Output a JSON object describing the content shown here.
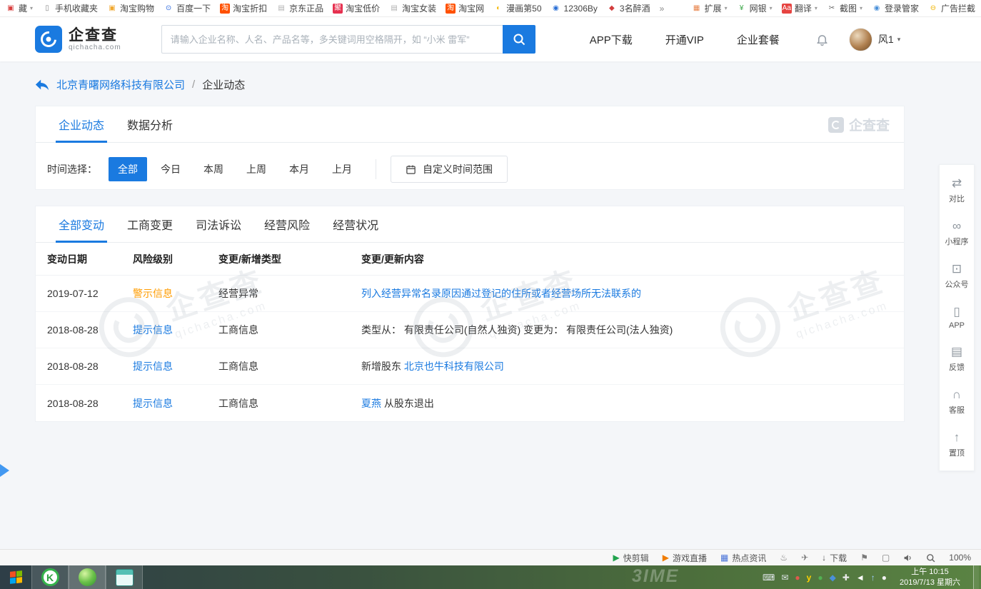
{
  "colors": {
    "brand": "#1a7ae0",
    "warning": "#ff9c00",
    "text": "#333333"
  },
  "bookmarks_bar": {
    "fold": {
      "glyph": "▣",
      "label": "藏",
      "icon_style": "color:#d94040"
    },
    "caret": "▾",
    "items": [
      {
        "label": "手机收藏夹",
        "glyph": "▯",
        "icon_style": "color:#8a8a8a"
      },
      {
        "label": "淘宝购物",
        "glyph": "▣",
        "icon_style": "color:#f0a830"
      },
      {
        "label": "百度一下",
        "glyph": "⊙",
        "icon_style": "color:#2d6adf"
      },
      {
        "label": "淘宝折扣",
        "glyph": "淘",
        "icon_style": "background:#ff5000;color:#fff"
      },
      {
        "label": "京东正品",
        "glyph": "▤",
        "icon_style": "color:#b0b0b0"
      },
      {
        "label": "淘宝低价",
        "glyph": "聚",
        "icon_style": "background:#e6304f;color:#fff"
      },
      {
        "label": "淘宝女装",
        "glyph": "▤",
        "icon_style": "color:#b0b0b0"
      },
      {
        "label": "淘宝网",
        "glyph": "淘",
        "icon_style": "background:#ff5000;color:#fff"
      },
      {
        "label": "漫画第50",
        "glyph": "◐",
        "icon_style": "color:#f5b800"
      },
      {
        "label": "12306By",
        "glyph": "◉",
        "icon_style": "color:#2a6fd6"
      },
      {
        "label": "3名醉酒",
        "glyph": "◆",
        "icon_style": "color:#d23c3c"
      }
    ],
    "overflow": "»",
    "right_items": [
      {
        "label": "扩展",
        "glyph": "▦",
        "icon_style": "color:#e8834a"
      },
      {
        "label": "网银",
        "glyph": "¥",
        "icon_style": "color:#3aa546"
      },
      {
        "label": "翻译",
        "glyph": "Aa",
        "icon_style": "background:#e64340;color:#fff"
      },
      {
        "label": "截图",
        "glyph": "✂",
        "icon_style": "color:#666"
      },
      {
        "label": "登录管家",
        "glyph": "◉",
        "icon_style": "color:#4a90d9"
      },
      {
        "label": "广告拦截",
        "glyph": "⊖",
        "icon_style": "color:#f0b400"
      }
    ]
  },
  "header": {
    "logo": {
      "name": "企查查",
      "domain": "qichacha.com"
    },
    "search": {
      "placeholder": "请输入企业名称、人名、产品名等，多关键词用空格隔开，如 “小米 雷军”"
    },
    "nav": [
      {
        "label": "APP下载"
      },
      {
        "label": "开通VIP"
      },
      {
        "label": "企业套餐"
      }
    ],
    "user": {
      "name": "风1",
      "caret": "▾"
    }
  },
  "breadcrumb": {
    "company": "北京青曙网络科技有限公司",
    "separator": "/",
    "current": "企业动态"
  },
  "dynamics": {
    "tabs": [
      {
        "label": "企业动态"
      },
      {
        "label": "数据分析"
      }
    ],
    "watermark_label": "企查查",
    "time_filter": {
      "label": "时间选择：",
      "options": [
        "全部",
        "今日",
        "本周",
        "上周",
        "本月",
        "上月"
      ],
      "active": "全部",
      "custom_label": "自定义时间范围"
    },
    "change_tabs": [
      "全部变动",
      "工商变更",
      "司法诉讼",
      "经营风险",
      "经营状况"
    ],
    "active_change_tab": "全部变动",
    "table": {
      "headers": [
        "变动日期",
        "风险级别",
        "变更/新增类型",
        "变更/更新内容"
      ],
      "rows": [
        {
          "date": "2019-07-12",
          "risk": "警示信息",
          "type": "经营异常",
          "text_before": "",
          "link_text": "列入经营异常名录原因通过登记的住所或者经营场所无法联系的",
          "text_after": ""
        },
        {
          "date": "2018-08-28",
          "risk": "提示信息",
          "type": "工商信息",
          "text_before": "类型从： 有限责任公司(自然人独资) 变更为： 有限责任公司(法人独资)",
          "link_text": "",
          "text_after": ""
        },
        {
          "date": "2018-08-28",
          "risk": "提示信息",
          "type": "工商信息",
          "text_before": "新增股东 ",
          "link_text": "北京也牛科技有限公司",
          "text_after": ""
        },
        {
          "date": "2018-08-28",
          "risk": "提示信息",
          "type": "工商信息",
          "text_before": "",
          "link_text": "夏燕",
          "text_after": " 从股东退出"
        }
      ]
    }
  },
  "right_toolbar": {
    "items": [
      {
        "label": "对比",
        "glyph": "⇄"
      },
      {
        "label": "小程序",
        "glyph": "∞"
      },
      {
        "label": "公众号",
        "glyph": "⊡"
      },
      {
        "label": "APP",
        "glyph": "▯"
      },
      {
        "label": "反馈",
        "glyph": "▤"
      },
      {
        "label": "客服",
        "glyph": "∩"
      },
      {
        "label": "置顶",
        "glyph": "↑"
      }
    ]
  },
  "watermark": {
    "text": "企查查",
    "sub": "qichacha.com"
  },
  "status_bar": {
    "tools": [
      {
        "glyph": "▶",
        "label": "快剪辑",
        "style": "color:#21a34e"
      },
      {
        "glyph": "▶",
        "label": "游戏直播",
        "style": "color:#f07c00"
      },
      {
        "glyph": "▦",
        "label": "热点资讯",
        "style": "color:#4a74d8"
      },
      {
        "glyph": "♨",
        "label": "",
        "style": "color:#7a7a7a"
      },
      {
        "glyph": "✈",
        "label": "",
        "style": "color:#7a7a7a"
      },
      {
        "glyph": "↓",
        "label": "下载",
        "style": "color:#555"
      },
      {
        "glyph": "⚑",
        "label": "",
        "style": "color:#7a7a7a"
      },
      {
        "glyph": "▢",
        "label": "",
        "style": "color:#7a7a7a"
      }
    ],
    "zoom": "100%"
  },
  "taskbar": {
    "apps": [
      {
        "glyph": "K"
      }
    ],
    "wallpaper_text": "3IME",
    "tray": [
      {
        "glyph": "⌨",
        "style": "color:#dfe5e8"
      },
      {
        "glyph": "✉",
        "style": "color:#dfe5e8"
      },
      {
        "glyph": "●",
        "style": "color:#e05a4e"
      },
      {
        "glyph": "y",
        "style": "color:#ffd200;font-weight:bold"
      },
      {
        "glyph": "●",
        "style": "color:#52b152"
      },
      {
        "glyph": "◆",
        "style": "color:#4a90d9"
      },
      {
        "glyph": "✚",
        "style": "color:#e8e8e8"
      },
      {
        "glyph": "◄",
        "style": "color:#ffffff"
      },
      {
        "glyph": "↑",
        "style": "color:#9fd0ff"
      },
      {
        "glyph": "●",
        "style": "color:#f0f0f0"
      }
    ],
    "clock": {
      "time": "上午 10:15",
      "date": "2019/7/13 星期六"
    }
  }
}
